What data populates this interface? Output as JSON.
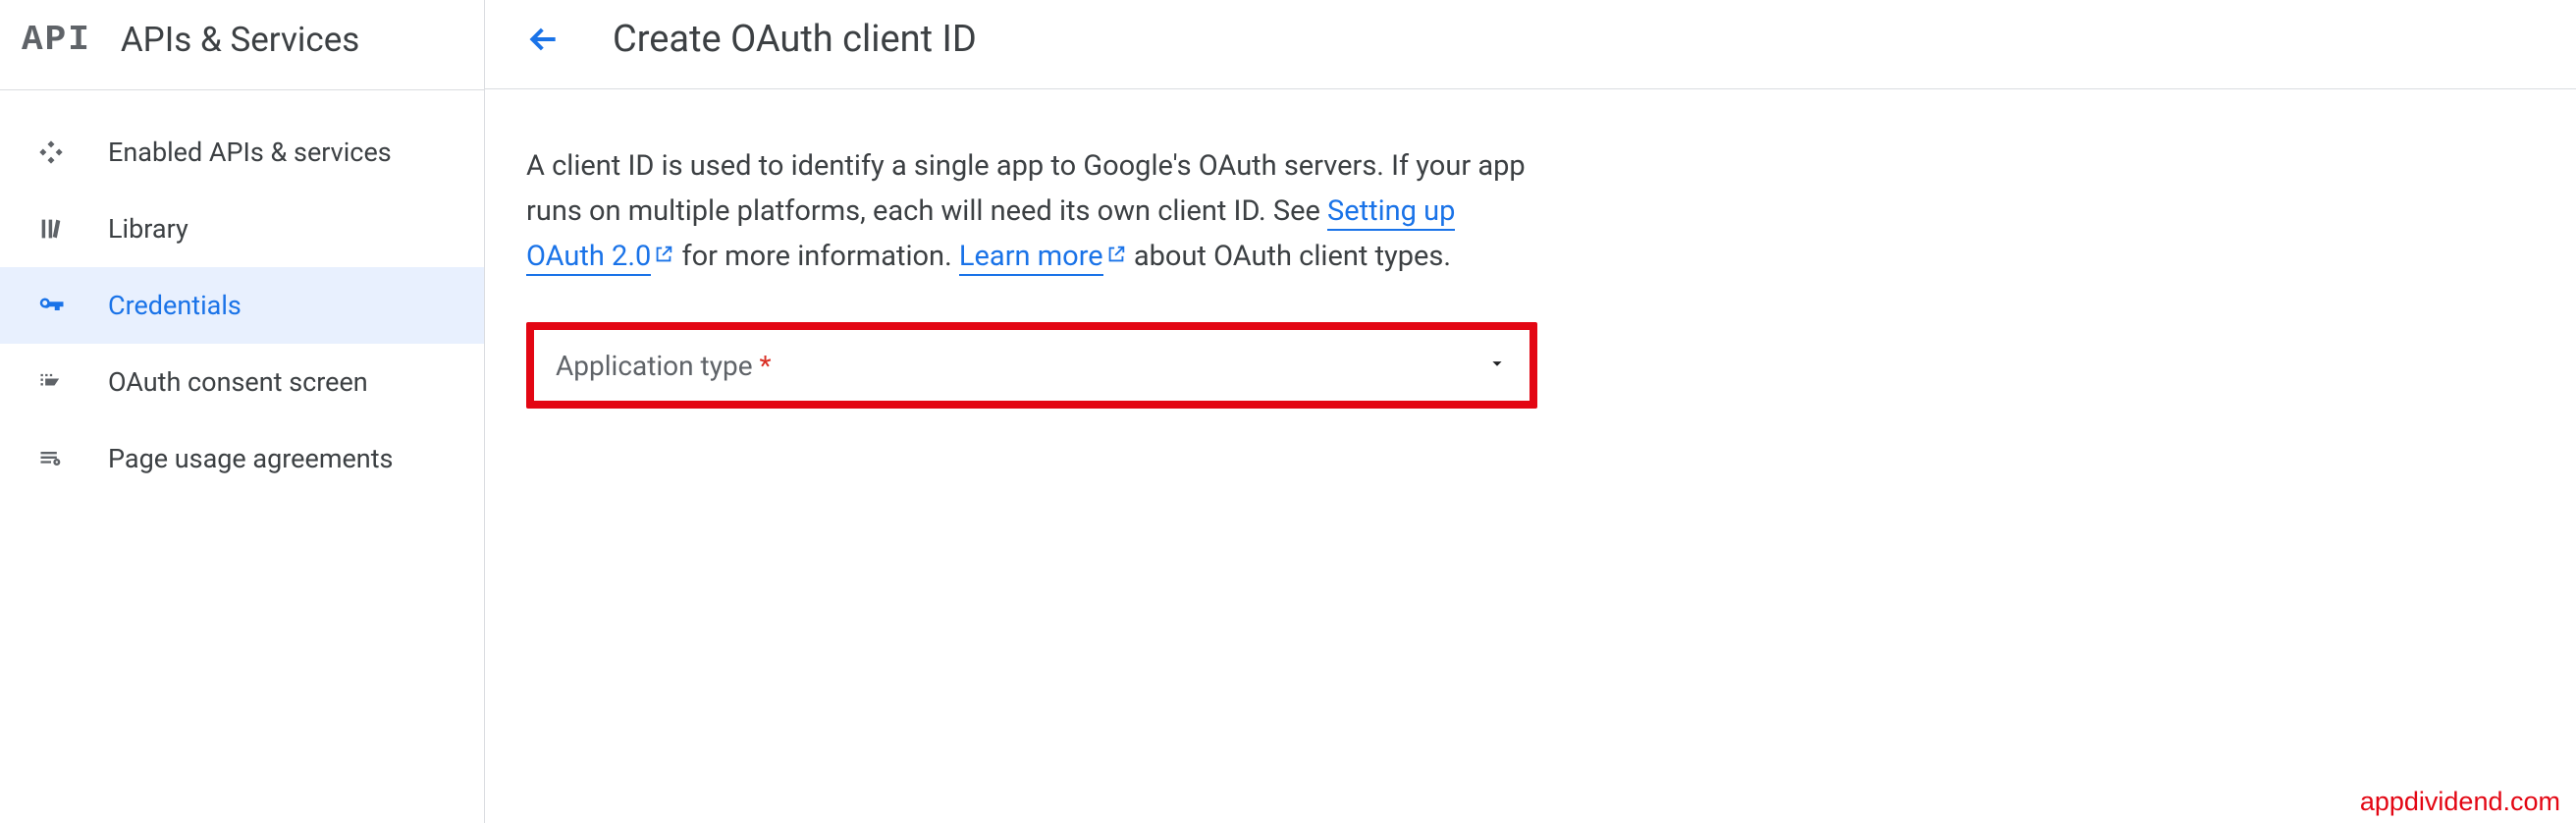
{
  "sidebar": {
    "logo_text": "API",
    "title": "APIs & Services",
    "items": [
      {
        "label": "Enabled APIs & services",
        "icon": "diamonds-icon",
        "active": false
      },
      {
        "label": "Library",
        "icon": "library-icon",
        "active": false
      },
      {
        "label": "Credentials",
        "icon": "key-icon",
        "active": true
      },
      {
        "label": "OAuth consent screen",
        "icon": "consent-icon",
        "active": false
      },
      {
        "label": "Page usage agreements",
        "icon": "agreements-icon",
        "active": false
      }
    ]
  },
  "main": {
    "page_title": "Create OAuth client ID",
    "description_part1": "A client ID is used to identify a single app to Google's OAuth servers. If your app runs on multiple platforms, each will need its own client ID. See ",
    "link1": "Setting up OAuth 2.0",
    "description_part2": " for more information. ",
    "link2": "Learn more",
    "description_part3": " about OAuth client types.",
    "select_label": "Application type ",
    "select_required": "*"
  },
  "watermark": "appdividend.com"
}
